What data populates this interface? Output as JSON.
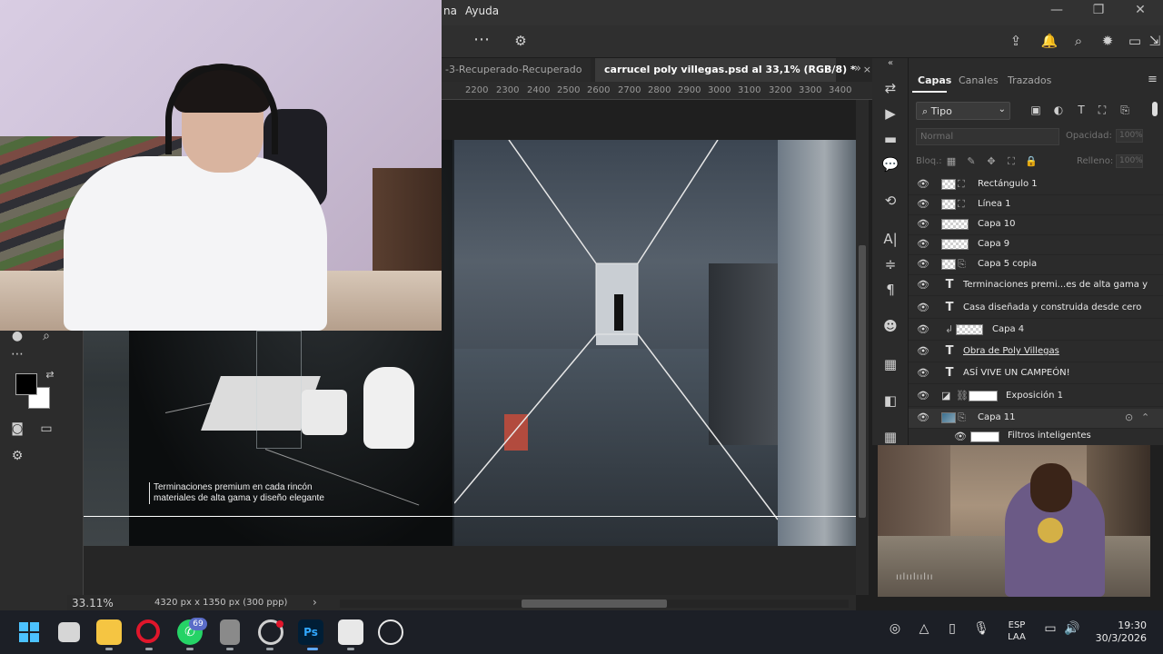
{
  "menu": {
    "items": [
      "na",
      "Ayuda"
    ],
    "window_controls": [
      "—",
      "❐",
      "✕"
    ]
  },
  "options_bar": {
    "more_icon": "⋯",
    "gear_icon": "⚙",
    "right_icons": [
      "⇪",
      "🔔",
      "⌕",
      "✹",
      "▭",
      "⇲"
    ]
  },
  "tabs": {
    "inactive_label": "-3-Recuperado-Recuperado",
    "active_label": "carrucel poly villegas.psd al 33,1% (RGB/8) *",
    "close": "×",
    "overflow": "»"
  },
  "ruler": {
    "ticks": [
      "2200",
      "2300",
      "2400",
      "2500",
      "2600",
      "2700",
      "2800",
      "2900",
      "3000",
      "3100",
      "3200",
      "3300",
      "3400"
    ]
  },
  "canvas": {
    "caption_line1": "Terminaciones premium en cada rincón",
    "caption_line2": "materiales de alta gama y diseño elegante"
  },
  "status": {
    "zoom": "33.11%",
    "doc_size": "4320 px x 1350 px (300 ppp)",
    "arrow": "›"
  },
  "panel": {
    "collapse_icon": "«",
    "tabs": [
      "Capas",
      "Canales",
      "Trazados"
    ],
    "menu_icon": "≡",
    "filter_label": "Tipo",
    "filter_icons": [
      "▣",
      "◐",
      "T",
      "⛶",
      "⎘"
    ],
    "blend_mode": "Normal",
    "opacity_label": "Opacidad:",
    "opacity_value": "100%",
    "lock_label": "Bloq.:",
    "fill_label": "Relleno:",
    "fill_value": "100%",
    "lock_icons": [
      "▦",
      "✎",
      "✥",
      "⛶",
      "🔒"
    ]
  },
  "layers": [
    {
      "name": "Rectángulo 1",
      "kind": "shape"
    },
    {
      "name": "Línea 1",
      "kind": "shape"
    },
    {
      "name": "Capa 10",
      "kind": "pixel"
    },
    {
      "name": "Capa 9",
      "kind": "pixel"
    },
    {
      "name": "Capa 5 copia",
      "kind": "smart"
    },
    {
      "name": "Terminaciones premi...es de alta gama y",
      "kind": "text"
    },
    {
      "name": "Casa diseñada y construida desde cero",
      "kind": "text"
    },
    {
      "name": "Capa 4",
      "kind": "clipped"
    },
    {
      "name": "Obra de Poly Villegas",
      "kind": "text-underline"
    },
    {
      "name": "ASÍ VIVE UN CAMPEÓN!",
      "kind": "text"
    },
    {
      "name": "Exposición 1",
      "kind": "adjustment"
    },
    {
      "name": "Capa 11",
      "kind": "smart-photo"
    },
    {
      "name": "Filtros inteligentes",
      "kind": "filters"
    }
  ],
  "strip_icons": [
    "⇄",
    "▶",
    "▬",
    "💬",
    "⟲",
    "A|",
    "≑",
    "¶",
    "☻",
    "▦",
    "◧",
    "▦"
  ],
  "video": {
    "eq": "ıılıılıılıı"
  },
  "taskbar": {
    "whatsapp_badge": "69",
    "lang_line1": "ESP",
    "lang_line2": "LAA",
    "time": "19:30",
    "date": "30/3/2026",
    "colors": {
      "opera": "#e0162b",
      "whatsapp": "#25d366",
      "photoshop": "#001e36",
      "ps_text": "#31a8ff",
      "explorer": "#f5c542"
    }
  }
}
